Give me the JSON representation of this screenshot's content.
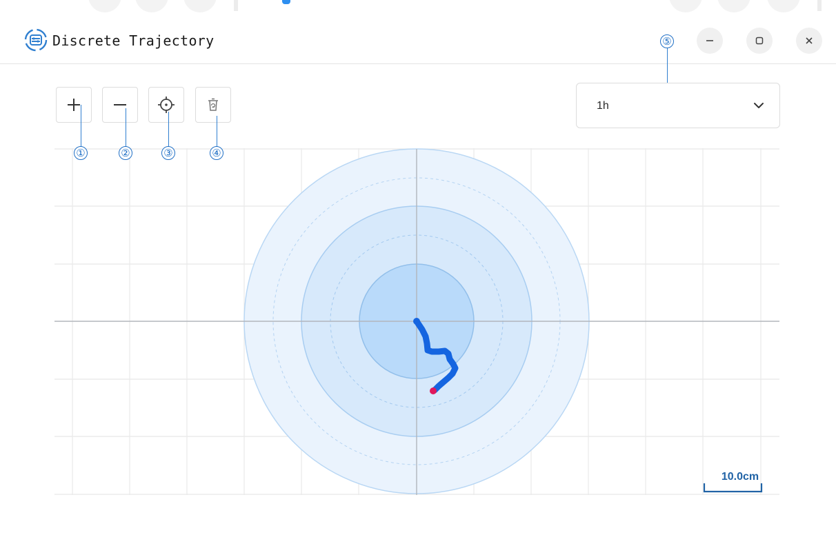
{
  "window": {
    "title": "Discrete Trajectory",
    "app_icon": "trajectory-logo-icon",
    "controls": [
      {
        "name": "minimize",
        "icon": "minimize-icon",
        "glyph": "−"
      },
      {
        "name": "maximize",
        "icon": "maximize-icon",
        "glyph": "▢"
      },
      {
        "name": "close",
        "icon": "close-icon",
        "glyph": "×"
      }
    ]
  },
  "toolbar": {
    "buttons": [
      {
        "name": "zoom-in",
        "icon": "plus-icon",
        "callout": "①"
      },
      {
        "name": "zoom-out",
        "icon": "minus-icon",
        "callout": "②"
      },
      {
        "name": "recenter",
        "icon": "crosshair-icon",
        "callout": "③"
      },
      {
        "name": "clear",
        "icon": "trash-icon",
        "callout": "④"
      }
    ]
  },
  "time_range": {
    "selected": "1h",
    "callout": "⑤",
    "icon": "chevron-down-icon"
  },
  "scale_bar": {
    "label": "10.0cm"
  },
  "colors": {
    "trajectory": "#1565e0",
    "current_point": "#e0185c",
    "ring_fill": "#d6e9fb",
    "ring_stroke": "#a9cef2",
    "accent": "#2163a6",
    "callout": "#1f6fc5"
  }
}
